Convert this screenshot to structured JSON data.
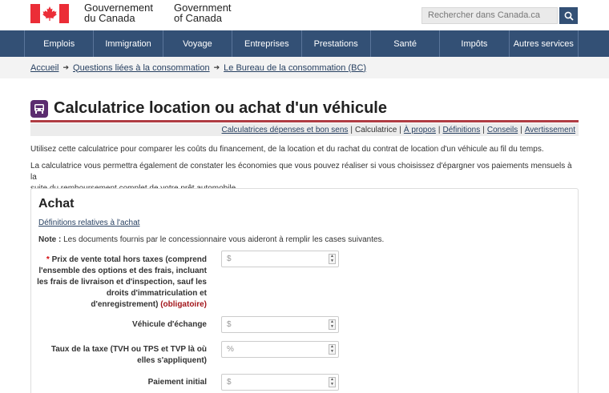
{
  "header": {
    "brand_fr_line1": "Gouvernement",
    "brand_fr_line2": "du Canada",
    "brand_en_line1": "Government",
    "brand_en_line2": "of Canada",
    "search_placeholder": "Rechercher dans Canada.ca",
    "search_icon": "search-icon"
  },
  "nav": {
    "items": [
      "Emplois",
      "Immigration",
      "Voyage",
      "Entreprises",
      "Prestations",
      "Santé",
      "Impôts",
      "Autres services"
    ]
  },
  "breadcrumb": {
    "items": [
      "Accueil",
      "Questions liées à la consommation",
      "Le Bureau de la consommation (BC)"
    ]
  },
  "page": {
    "title": "Calculatrice location ou achat d'un véhicule",
    "sublinks": [
      "Calculatrices dépenses et bon sens",
      "Calculatrice",
      "À propos",
      "Définitions",
      "Conseils",
      "Avertissement"
    ],
    "intro1": "Utilisez cette calculatrice pour comparer les coûts du financement, de la location et du rachat du contrat de location d'un véhicule au fil du temps.",
    "intro2_line1": "La calculatrice vous permettra également de constater les économies que vous pouvez réaliser si vous choisissez d'épargner vos paiements mensuels à la",
    "intro2_line2": "suite du remboursement complet de votre prêt automobile."
  },
  "panel": {
    "title": "Achat",
    "definitions_link": "Définitions relatives à l'achat",
    "note_label": "Note :",
    "note_text": "Les documents fournis par le concessionnaire vous aideront à remplir les cases suivantes.",
    "fields": [
      {
        "star": "*",
        "label_lines": [
          "Prix de vente total hors taxes (comprend",
          "l'ensemble des options et des frais, incluant",
          "les frais de livraison et d'inspection, sauf les",
          "droits d'immatriculation et",
          "d'enregistrement)"
        ],
        "required": "(obligatoire)",
        "placeholder": "$"
      },
      {
        "label_lines": [
          "Véhicule d'échange"
        ],
        "placeholder": "$"
      },
      {
        "label_lines": [
          "Taux de la taxe (TVH ou TPS et TVP là où",
          "elles s'appliquent)"
        ],
        "placeholder": "%"
      },
      {
        "label_lines": [
          "Paiement initial"
        ],
        "placeholder": "$"
      }
    ]
  },
  "colors": {
    "nav_bg": "#335075",
    "accent_rule": "#af3c43",
    "link": "#284162",
    "required": "#a3161b"
  }
}
